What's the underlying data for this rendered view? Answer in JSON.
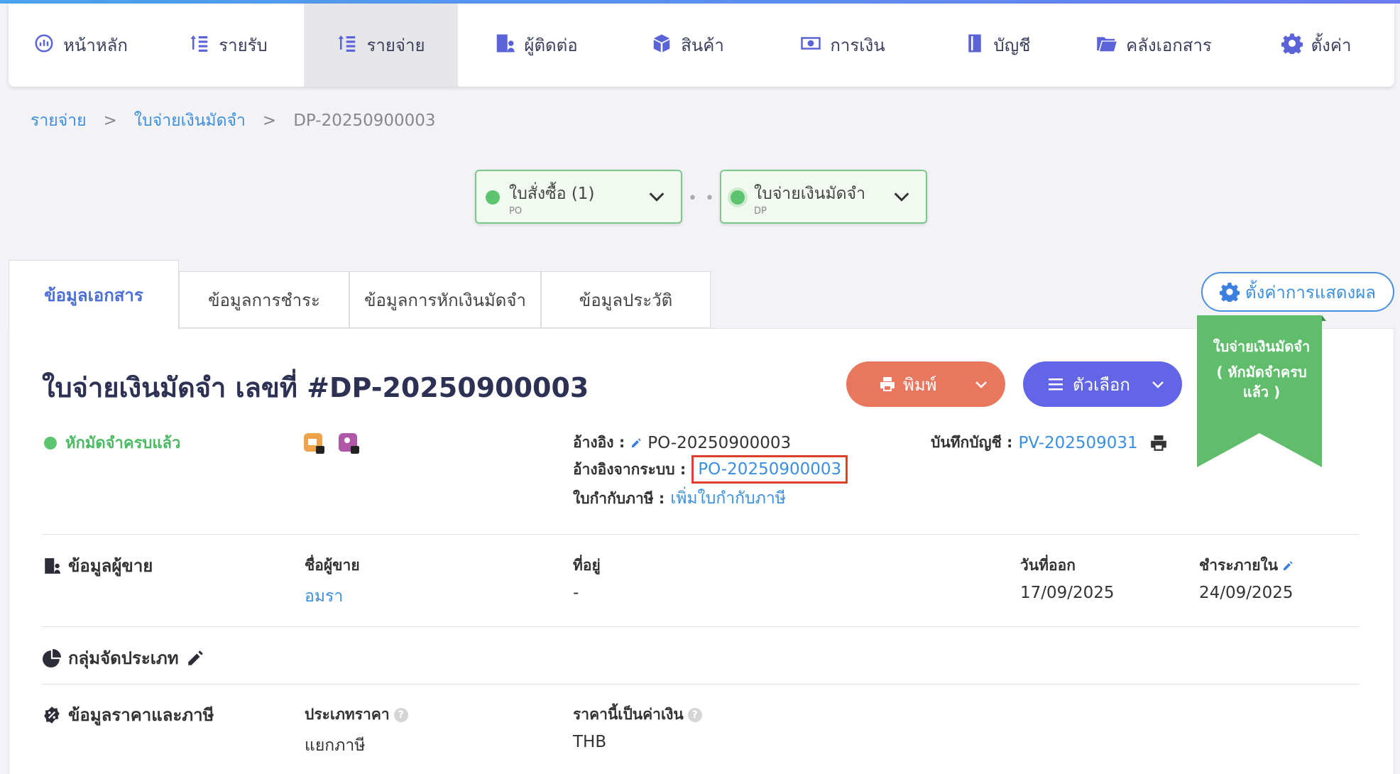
{
  "nav": {
    "items": [
      {
        "label": "หน้าหลัก",
        "icon": "dashboard-icon"
      },
      {
        "label": "รายรับ",
        "icon": "income-list-icon"
      },
      {
        "label": "รายจ่าย",
        "icon": "expense-list-icon",
        "active": true
      },
      {
        "label": "ผู้ติดต่อ",
        "icon": "contacts-building-icon"
      },
      {
        "label": "สินค้า",
        "icon": "box-icon"
      },
      {
        "label": "การเงิน",
        "icon": "money-icon"
      },
      {
        "label": "บัญชี",
        "icon": "ledger-book-icon"
      },
      {
        "label": "คลังเอกสาร",
        "icon": "folder-icon"
      },
      {
        "label": "ตั้งค่า",
        "icon": "gear-icon"
      }
    ]
  },
  "breadcrumb": {
    "level1": "รายจ่าย",
    "level2": "ใบจ่ายเงินมัดจำ",
    "current": "DP-20250900003",
    "separator": ">"
  },
  "flow": {
    "po": {
      "title": "ใบสั่งซื้อ (1)",
      "sub": "PO"
    },
    "dp": {
      "title": "ใบจ่ายเงินมัดจำ",
      "sub": "DP"
    },
    "connector": "• • •"
  },
  "tabs": [
    {
      "label": "ข้อมูลเอกสาร"
    },
    {
      "label": "ข้อมูลการชำระ"
    },
    {
      "label": "ข้อมูลการหักเงินมัดจำ"
    },
    {
      "label": "ข้อมูลประวัติ"
    }
  ],
  "display_settings_label": "ตั้งค่าการแสดงผล",
  "document": {
    "title": "ใบจ่ายเงินมัดจำ เลขที่ #DP-20250900003",
    "print_label": "พิมพ์",
    "options_label": "ตัวเลือก",
    "ribbon_line1": "ใบจ่ายเงินมัดจำ",
    "ribbon_line2": "( หักมัดจำครบ",
    "ribbon_line3": "แล้ว )",
    "status": "หักมัดจำครบแล้ว",
    "reference_label": "อ้างอิง :",
    "reference_value": "PO-20250900003",
    "system_ref_label": "อ้างอิงจากระบบ :",
    "system_ref_value": "PO-20250900003",
    "tax_invoice_label": "ใบกำกับภาษี :",
    "tax_invoice_link": "เพิ่มใบกำกับภาษี",
    "journal_label": "บันทึกบัญชี :",
    "journal_value": "PV-202509031"
  },
  "vendor": {
    "section_title": "ข้อมูลผู้ขาย",
    "name_label": "ชื่อผู้ขาย",
    "name_value": "อมรา",
    "address_label": "ที่อยู่",
    "address_value": "-",
    "issue_date_label": "วันที่ออก",
    "issue_date_value": "17/09/2025",
    "due_label": "ชำระภายใน",
    "due_value": "24/09/2025"
  },
  "category": {
    "section_title": "กลุ่มจัดประเภท"
  },
  "pricing": {
    "section_title": "ข้อมูลราคาและภาษี",
    "price_type_label": "ประเภทราคา",
    "price_type_value": "แยกภาษี",
    "currency_label": "ราคานี้เป็นค่าเงิน",
    "currency_value": "THB",
    "help_glyph": "?"
  },
  "colors": {
    "accent_blue": "#3b8fe0",
    "print_button": "#e8775d",
    "options_button": "#6266e6",
    "status_green": "#4cba63",
    "ribbon_green": "#5fbd6c",
    "highlight_red": "#e0402a"
  }
}
